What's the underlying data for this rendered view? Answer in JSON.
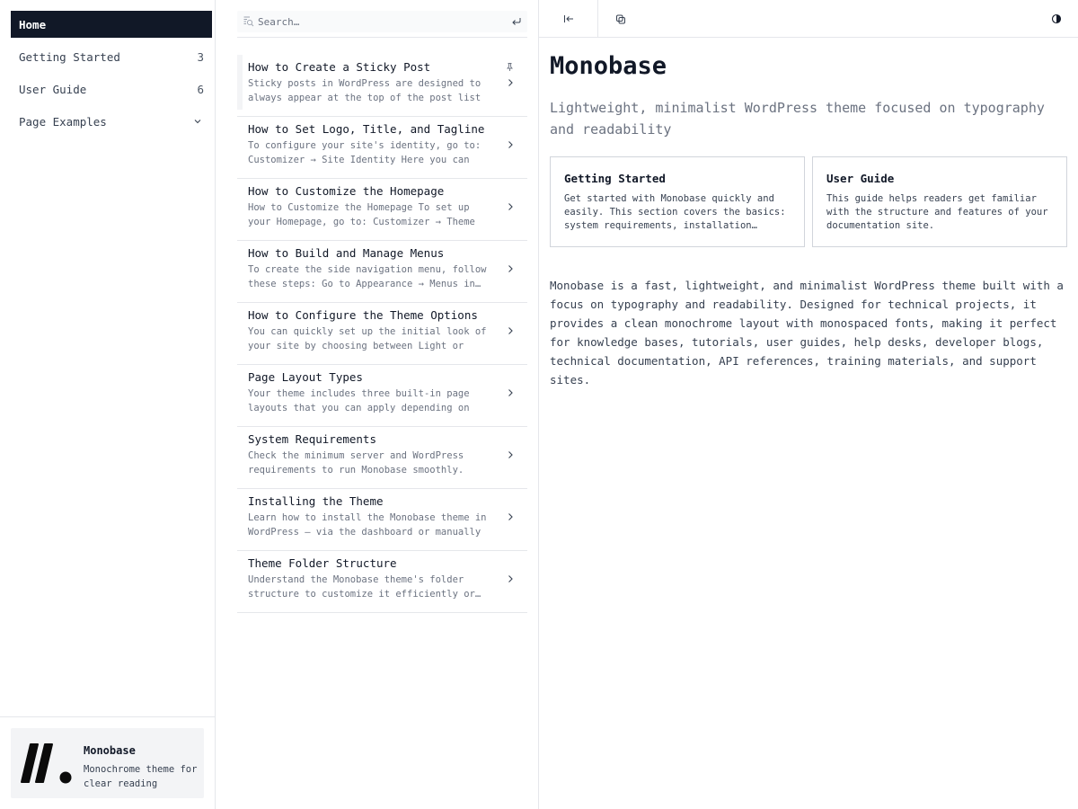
{
  "sidebar": {
    "items": [
      {
        "label": "Home",
        "count": ""
      },
      {
        "label": "Getting Started",
        "count": "3"
      },
      {
        "label": "User Guide",
        "count": "6"
      },
      {
        "label": "Page Examples",
        "count": ""
      }
    ],
    "brand": {
      "name": "Monobase",
      "description": "Monochrome theme for clear reading"
    }
  },
  "search": {
    "placeholder": "Search…"
  },
  "posts": [
    {
      "title": "How to Create a Sticky Post",
      "excerpt": "Sticky posts in WordPress are designed to always appear at the top of the post list –…",
      "sticky": true
    },
    {
      "title": "How to Set Logo, Title, and Tagline",
      "excerpt": "To configure your site's identity, go to: Customizer → Site Identity Here you can set…"
    },
    {
      "title": "How to Customize the Homepage",
      "excerpt": "How to Customize the Homepage To set up your Homepage, go to: Customizer → Theme Options…"
    },
    {
      "title": "How to Build and Manage Menus",
      "excerpt": "To create the side navigation menu, follow these steps: Go to Appearance → Menus in…"
    },
    {
      "title": "How to Configure the Theme Options",
      "excerpt": "You can quickly set up the initial look of your site by choosing between Light or Dark…"
    },
    {
      "title": "Page Layout Types",
      "excerpt": "Your theme includes three built-in page layouts that you can apply depending on the…"
    },
    {
      "title": "System Requirements",
      "excerpt": "Check the minimum server and WordPress requirements to run Monobase smoothly."
    },
    {
      "title": "Installing the Theme",
      "excerpt": "Learn how to install the Monobase theme in WordPress — via the dashboard or manually b…"
    },
    {
      "title": "Theme Folder Structure",
      "excerpt": "Understand the Monobase theme's folder structure to customize it efficiently or…"
    }
  ],
  "main": {
    "title": "Monobase",
    "subtitle": "Lightweight, minimalist WordPress theme focused on typography and readability",
    "cards": [
      {
        "title": "Getting Started",
        "description": "Get started with Monobase quickly and easily. This section covers the basics: system requirements, installation…"
      },
      {
        "title": "User Guide",
        "description": "This guide helps readers get familiar with the structure and features of your documentation site."
      }
    ],
    "body": "Monobase is a fast, lightweight, and minimalist WordPress theme built with a focus on typography and readability. Designed for technical projects, it provides a clean monochrome layout with monospaced fonts, making it perfect for knowledge bases, tutorials, user guides, help desks, developer blogs, technical documentation, API references, training materials, and support sites."
  },
  "icons": {
    "collapse": "collapse-sidebar-icon",
    "copy": "copy-link-icon",
    "theme": "contrast-icon",
    "search": "search-icon",
    "enter": "enter-icon",
    "pin": "pin-icon",
    "chevron": "chevron-right-icon"
  },
  "colors": {
    "accent": "#111827",
    "muted": "#6b7280",
    "border": "#e5e7eb"
  }
}
